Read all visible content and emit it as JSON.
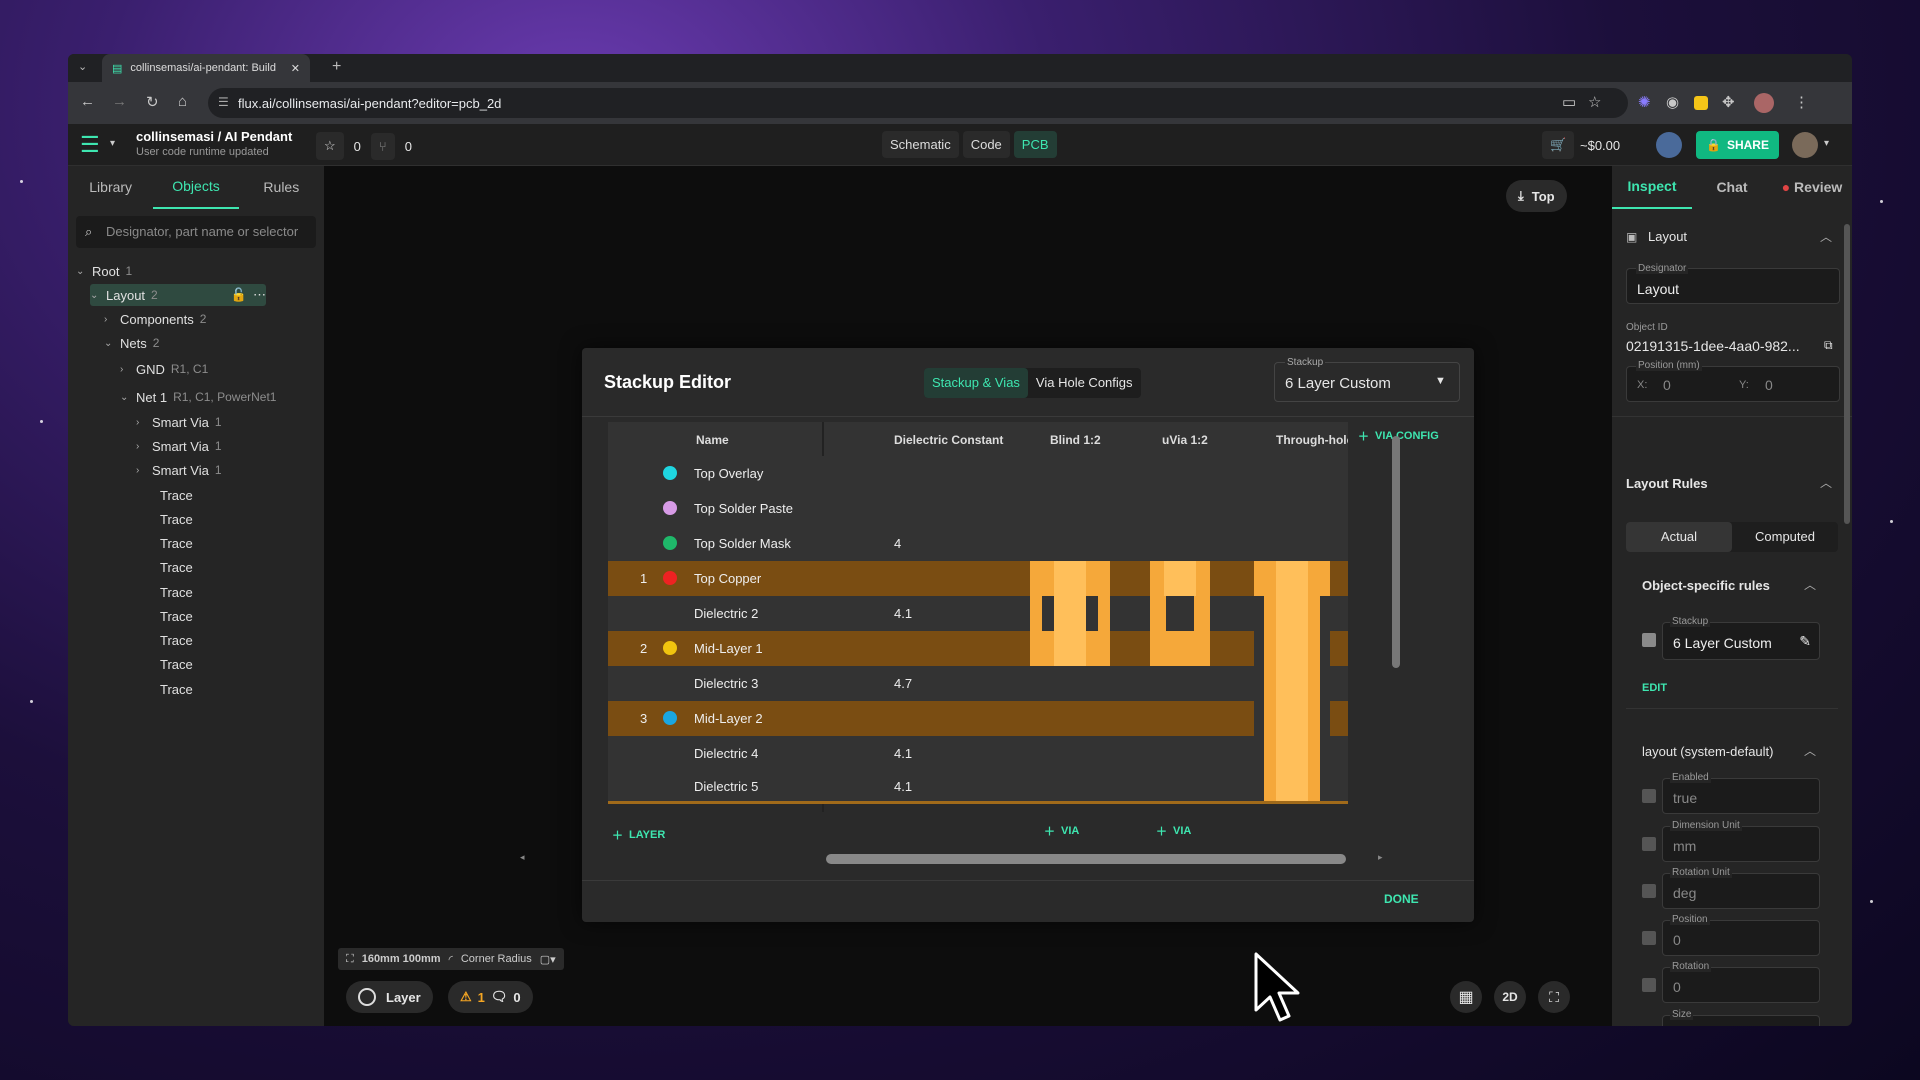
{
  "browser": {
    "tab_title": "collinsemasi/ai-pendant: Build",
    "url": "flux.ai/collinsemasi/ai-pendant?editor=pcb_2d"
  },
  "header": {
    "project": "collinsemasi / AI Pendant",
    "subtitle": "User code runtime updated",
    "stars": "0",
    "forks": "0",
    "modes": [
      "Schematic",
      "Code",
      "PCB"
    ],
    "price": "~$0.00",
    "share": "SHARE"
  },
  "left": {
    "tabs": [
      "Library",
      "Objects",
      "Rules"
    ],
    "search_placeholder": "Designator, part name or selector",
    "tree": [
      {
        "label": "Root",
        "sub": "1"
      },
      {
        "label": "Layout",
        "sub": "2"
      },
      {
        "label": "Components",
        "sub": "2"
      },
      {
        "label": "Nets",
        "sub": "2"
      },
      {
        "label": "GND",
        "sub": "R1, C1"
      },
      {
        "label": "Net 1",
        "sub": "R1, C1, PowerNet1"
      },
      {
        "label": "Smart Via",
        "sub": "1"
      },
      {
        "label": "Smart Via",
        "sub": "1"
      },
      {
        "label": "Smart Via",
        "sub": "1"
      },
      {
        "label": "Trace",
        "sub": ""
      },
      {
        "label": "Trace",
        "sub": ""
      },
      {
        "label": "Trace",
        "sub": ""
      },
      {
        "label": "Trace",
        "sub": ""
      },
      {
        "label": "Trace",
        "sub": ""
      },
      {
        "label": "Trace",
        "sub": ""
      },
      {
        "label": "Trace",
        "sub": ""
      },
      {
        "label": "Trace",
        "sub": ""
      },
      {
        "label": "Trace",
        "sub": ""
      }
    ]
  },
  "canvas": {
    "view_button": "Top",
    "size": "160mm 100mm",
    "corner_radius": "Corner Radius",
    "layer": "Layer",
    "warnings": "1",
    "comments": "0",
    "view_mode": "2D"
  },
  "dialog": {
    "title": "Stackup Editor",
    "tabs": [
      "Stackup & Vias",
      "Via Hole Configs"
    ],
    "stackup_label": "Stackup",
    "stackup_value": "6 Layer Custom",
    "columns": [
      "Name",
      "Dielectric Constant",
      "Blind 1:2",
      "uVia 1:2",
      "Through-hole"
    ],
    "via_config": "VIA CONFIG",
    "rows": [
      {
        "num": "",
        "name": "Top Overlay",
        "dk": "",
        "color": "#1fd6e0"
      },
      {
        "num": "",
        "name": "Top Solder Paste",
        "dk": "",
        "color": "#d79be6"
      },
      {
        "num": "",
        "name": "Top Solder Mask",
        "dk": "4",
        "color": "#1fb86a"
      },
      {
        "num": "1",
        "name": "Top Copper",
        "dk": "",
        "color": "#ee2222"
      },
      {
        "num": "",
        "name": "Dielectric 2",
        "dk": "4.1",
        "color": ""
      },
      {
        "num": "2",
        "name": "Mid-Layer 1",
        "dk": "",
        "color": "#f1c40f"
      },
      {
        "num": "",
        "name": "Dielectric 3",
        "dk": "4.7",
        "color": ""
      },
      {
        "num": "3",
        "name": "Mid-Layer 2",
        "dk": "",
        "color": "#1aa6e0"
      },
      {
        "num": "",
        "name": "Dielectric 4",
        "dk": "4.1",
        "color": ""
      },
      {
        "num": "",
        "name": "Dielectric 5",
        "dk": "4.1",
        "color": ""
      }
    ],
    "add_layer": "LAYER",
    "add_via": "VIA",
    "done": "DONE"
  },
  "right": {
    "tabs": [
      "Inspect",
      "Chat",
      "Review"
    ],
    "section": "Layout",
    "designator_label": "Designator",
    "designator": "Layout",
    "object_id_label": "Object ID",
    "object_id": "02191315-1dee-4aa0-982...",
    "position_label": "Position (mm)",
    "x_label": "X:",
    "x": "0",
    "y_label": "Y:",
    "y": "0",
    "layout_rules": "Layout Rules",
    "actual": "Actual",
    "computed": "Computed",
    "object_rules": "Object-specific rules",
    "stackup_label": "Stackup",
    "stackup_value": "6 Layer Custom",
    "edit": "EDIT",
    "system_default": "layout (system-default)",
    "rules": [
      {
        "label": "Enabled",
        "value": "true"
      },
      {
        "label": "Dimension Unit",
        "value": "mm"
      },
      {
        "label": "Rotation Unit",
        "value": "deg"
      },
      {
        "label": "Position",
        "value": "0"
      },
      {
        "label": "Rotation",
        "value": "0"
      },
      {
        "label": "Size",
        "value": ""
      }
    ]
  },
  "colors": {
    "accent": "#3ee6b0",
    "copper": "#7a4d12",
    "via": "#f5a83a"
  }
}
